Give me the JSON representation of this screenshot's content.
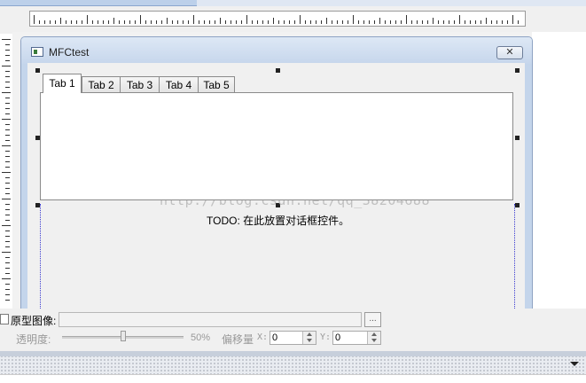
{
  "dialog": {
    "title": "MFCtest",
    "close_label": "✕"
  },
  "tabs": [
    {
      "label": "Tab 1",
      "active": true
    },
    {
      "label": "Tab 2",
      "active": false
    },
    {
      "label": "Tab 3",
      "active": false
    },
    {
      "label": "Tab 4",
      "active": false
    },
    {
      "label": "Tab 5",
      "active": false
    }
  ],
  "content": {
    "todo_text": "TODO: 在此放置对话框控件。",
    "watermark": "http://blog.csdn.net/qq_38204688"
  },
  "prototype": {
    "label": "原型图像:",
    "path_value": "",
    "browse_label": "..."
  },
  "opacity": {
    "label": "透明度:",
    "value_text": "50%",
    "value": 0.5
  },
  "offset": {
    "label": "偏移量",
    "x_label": "X:",
    "x_value": "0",
    "y_label": "Y:",
    "y_value": "0"
  },
  "icons": {
    "app": "window-icon",
    "close": "close-icon",
    "dropdown": "chevron-down-icon"
  }
}
